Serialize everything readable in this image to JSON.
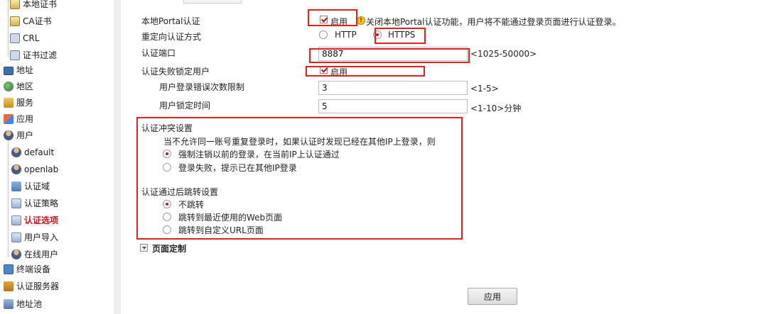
{
  "sidebar": {
    "items": [
      {
        "label": "本地证书",
        "icon": "certificate-icon"
      },
      {
        "label": "CA证书",
        "icon": "certificate-icon"
      },
      {
        "label": "CRL",
        "icon": "crl-icon"
      },
      {
        "label": "证书过滤",
        "icon": "certificate-filter-icon"
      },
      {
        "label": "地址",
        "icon": "monitor-icon"
      },
      {
        "label": "地区",
        "icon": "globe-icon"
      },
      {
        "label": "服务",
        "icon": "service-icon"
      },
      {
        "label": "应用",
        "icon": "application-icon"
      },
      {
        "label": "用户",
        "icon": "user-icon"
      },
      {
        "label": "default",
        "icon": "user-group-icon"
      },
      {
        "label": "openlab",
        "icon": "user-group-icon"
      },
      {
        "label": "认证域",
        "icon": "auth-domain-icon"
      },
      {
        "label": "认证策略",
        "icon": "auth-policy-icon"
      },
      {
        "label": "认证选项",
        "icon": "auth-option-icon"
      },
      {
        "label": "用户导入",
        "icon": "user-import-icon"
      },
      {
        "label": "在线用户",
        "icon": "online-user-icon"
      },
      {
        "label": "终端设备",
        "icon": "terminal-device-icon"
      },
      {
        "label": "认证服务器",
        "icon": "auth-server-icon"
      },
      {
        "label": "地址池",
        "icon": "address-pool-icon"
      }
    ],
    "active_label": "认证选项"
  },
  "form": {
    "local_portal": {
      "label": "本地Portal认证",
      "checkbox_label": "启用",
      "checked": true,
      "warning": "关闭本地Portal认证功能，用户将不能通过登录页面进行认证登录。"
    },
    "redirect_method": {
      "label": "重定向认证方式",
      "options": [
        "HTTP",
        "HTTPS"
      ],
      "selected": "HTTPS"
    },
    "auth_port": {
      "label": "认证端口",
      "value": "8887",
      "hint": "<1025-50000>"
    },
    "lock_user": {
      "label": "认证失败锁定用户",
      "checkbox_label": "启用",
      "checked": true
    },
    "login_error_limit": {
      "label": "用户登录错误次数限制",
      "value": "3",
      "hint": "<1-5>"
    },
    "lock_time": {
      "label": "用户锁定时间",
      "value": "5",
      "hint": "<1-10>分钟"
    },
    "conflict": {
      "title": "认证冲突设置",
      "description": "当不允许同一账号重复登录时，如果认证时发现已经在其他IP上登录，则",
      "options": [
        "强制注销以前的登录，在当前IP上认证通过",
        "登录失败，提示已在其他IP登录"
      ],
      "selected_index": 0
    },
    "redirect_after": {
      "title": "认证通过后跳转设置",
      "options": [
        "不跳转",
        "跳转到最近使用的Web页面",
        "跳转到自定义URL页面"
      ],
      "selected_index": 0
    },
    "page_custom": {
      "label": "页面定制"
    },
    "apply_label": "应用"
  },
  "colors": {
    "highlight_box": "#e0201c",
    "active_nav": "#c4161c"
  }
}
